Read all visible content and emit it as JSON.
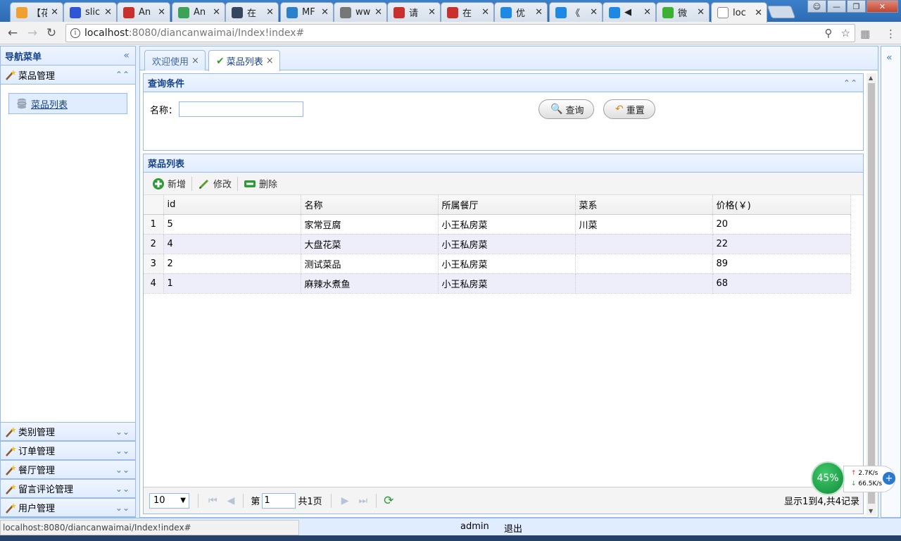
{
  "browser": {
    "tabs": [
      {
        "label": "【花",
        "icon": "weather-icon",
        "color": "#f0a030"
      },
      {
        "label": "slic",
        "icon": "baidu-paw-icon",
        "color": "#2e56d6"
      },
      {
        "label": "An",
        "icon": "csdn-c-icon",
        "color": "#c9302c"
      },
      {
        "label": "An",
        "icon": "refresh-c-icon",
        "color": "#3aa357"
      },
      {
        "label": "在",
        "icon": "tumblr-t-icon",
        "color": "#35465c"
      },
      {
        "label": "MF",
        "icon": "globe-icon",
        "color": "#2a80c9"
      },
      {
        "label": "ww",
        "icon": "paw-icon",
        "color": "#777777"
      },
      {
        "label": "请",
        "icon": "csdn-c-icon",
        "color": "#c9302c"
      },
      {
        "label": "在",
        "icon": "csdn-c-icon",
        "color": "#c9302c"
      },
      {
        "label": "优",
        "icon": "play-icon",
        "color": "#1e88e5"
      },
      {
        "label": "《",
        "icon": "play-icon",
        "color": "#1e88e5"
      },
      {
        "label": "◀",
        "icon": "play-icon",
        "color": "#1e88e5"
      },
      {
        "label": "微",
        "icon": "wechat-icon",
        "color": "#3cb034"
      },
      {
        "label": "loc",
        "icon": "page-icon",
        "color": "#ffffff",
        "active": true
      }
    ],
    "url_host": "localhost",
    "url_path": ":8080/diancanwaimai/Index!index#"
  },
  "west": {
    "title": "导航菜单",
    "active_section": "菜品管理",
    "active_items": [
      "菜品列表"
    ],
    "sections": [
      "类别管理",
      "订单管理",
      "餐厅管理",
      "留言评论管理",
      "用户管理"
    ]
  },
  "center_tabs": [
    {
      "label": "欢迎使用"
    },
    {
      "label": "菜品列表"
    }
  ],
  "query": {
    "title": "查询条件",
    "name_label": "名称：",
    "name_value": "",
    "search_label": "查询",
    "reset_label": "重置"
  },
  "list": {
    "title": "菜品列表",
    "toolbar": {
      "add": "新增",
      "edit": "修改",
      "delete": "删除"
    },
    "columns": [
      "id",
      "名称",
      "所属餐厅",
      "菜系",
      "价格(￥)"
    ],
    "rows": [
      {
        "rn": "1",
        "id": "5",
        "name": "家常豆腐",
        "restaurant": "小王私房菜",
        "cuisine": "川菜",
        "price": "20"
      },
      {
        "rn": "2",
        "id": "4",
        "name": "大盘花菜",
        "restaurant": "小王私房菜",
        "cuisine": "",
        "price": "22"
      },
      {
        "rn": "3",
        "id": "2",
        "name": "测试菜品",
        "restaurant": "小王私房菜",
        "cuisine": "",
        "price": "89"
      },
      {
        "rn": "4",
        "id": "1",
        "name": "麻辣水煮鱼",
        "restaurant": "小王私房菜",
        "cuisine": "",
        "price": "68"
      }
    ],
    "pager": {
      "page_size": "10",
      "page_prefix": "第",
      "page_value": "1",
      "page_total": "共1页",
      "info": "显示1到4,共4记录"
    }
  },
  "statusbar": {
    "link_tip": "localhost:8080/diancanwaimai/Index!index#",
    "user": "admin",
    "logout": "退出"
  },
  "net_widget": {
    "percent": "45%",
    "up": "2.7K/s",
    "down": "66.5K/s"
  }
}
